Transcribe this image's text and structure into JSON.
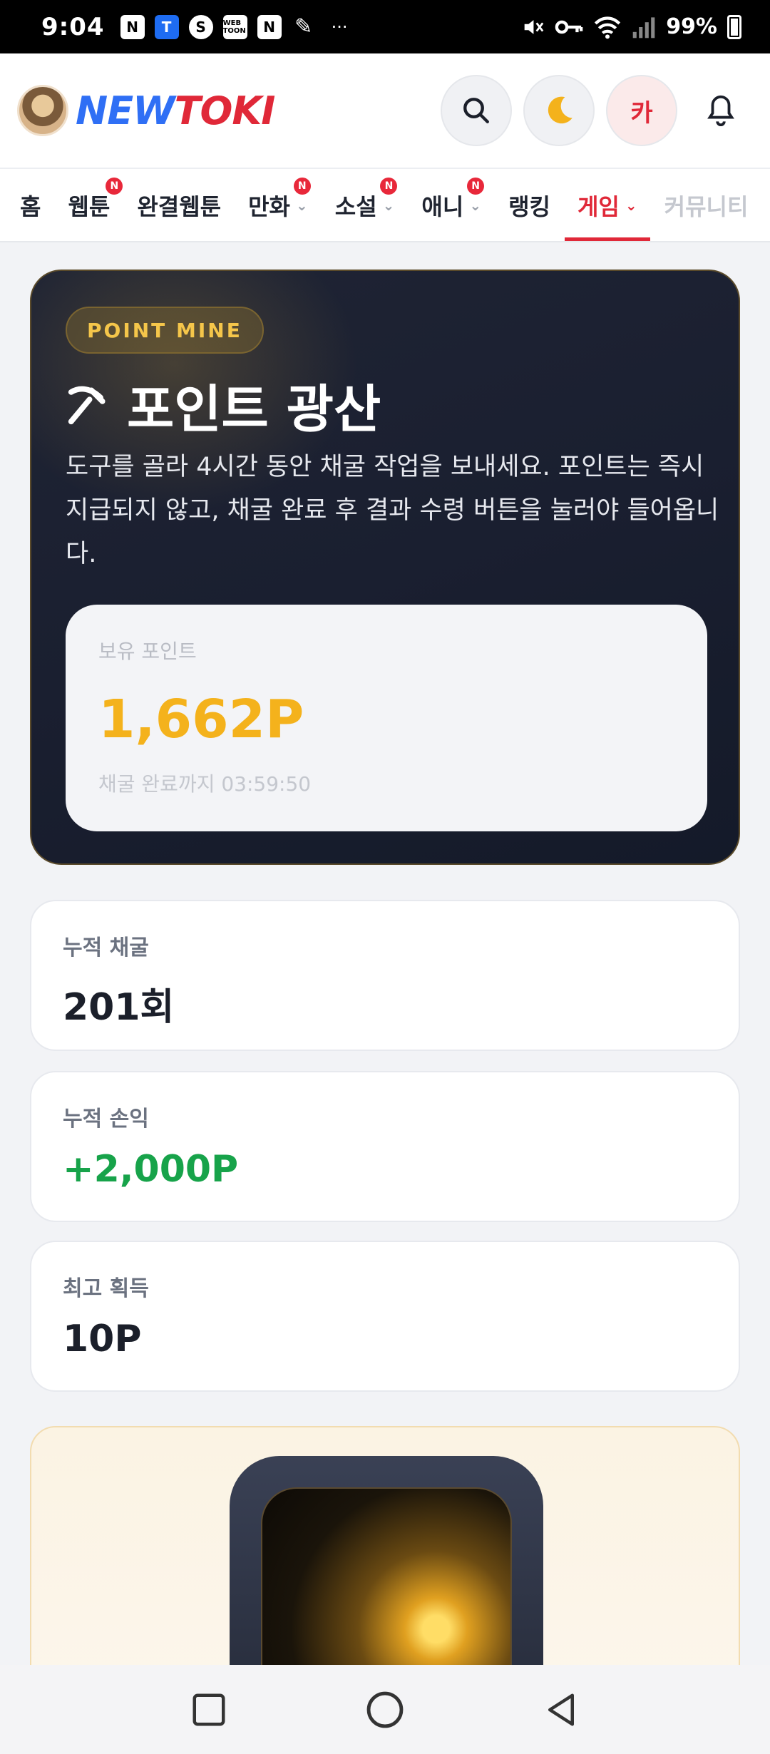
{
  "status_bar": {
    "time": "9:04",
    "app_icons": [
      "N",
      "T",
      "S",
      "WEB TOON",
      "N",
      "✎"
    ],
    "more": "···",
    "battery": "99%"
  },
  "header": {
    "logo_new": "NEW",
    "logo_toki": "TOKI",
    "user_initial": "카"
  },
  "nav": {
    "tabs": [
      {
        "label": "홈",
        "badge": "",
        "chevron": false
      },
      {
        "label": "웹툰",
        "badge": "N",
        "chevron": false
      },
      {
        "label": "완결웹툰",
        "badge": "",
        "chevron": false
      },
      {
        "label": "만화",
        "badge": "N",
        "chevron": true
      },
      {
        "label": "소설",
        "badge": "N",
        "chevron": true
      },
      {
        "label": "애니",
        "badge": "N",
        "chevron": true
      },
      {
        "label": "랭킹",
        "badge": "",
        "chevron": false
      },
      {
        "label": "게임",
        "badge": "",
        "chevron": true
      },
      {
        "label": "커뮤니티",
        "badge": "",
        "chevron": false
      }
    ]
  },
  "hero": {
    "pill": "POINT MINE",
    "title": "포인트 광산",
    "description": "도구를 골라 4시간 동안 채굴 작업을 보내세요. 포인트는 즉시 지급되지 않고, 채굴 완료 후 결과 수령 버튼을 눌러야 들어옵니다.",
    "points_label": "보유 포인트",
    "points_value": "1,662P",
    "timer": "채굴 완료까지 03:59:50"
  },
  "stats": [
    {
      "label": "누적 채굴",
      "value": "201회"
    },
    {
      "label": "누적 손익",
      "value": "+2,000P"
    },
    {
      "label": "최고 획득",
      "value": "10P"
    }
  ],
  "colors": {
    "accent_red": "#e02838",
    "brand_blue": "#2f6ff5",
    "gold": "#f4b21c",
    "profit_green": "#17a34a"
  }
}
